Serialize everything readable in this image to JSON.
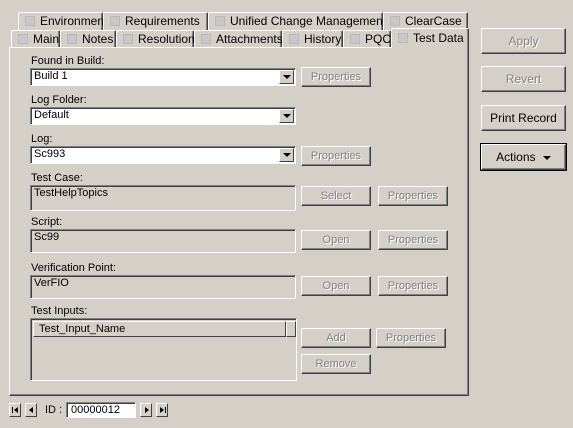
{
  "tabs_row1": [
    {
      "label": "Environment"
    },
    {
      "label": "Requirements"
    },
    {
      "label": "Unified Change Management"
    },
    {
      "label": "ClearCase"
    }
  ],
  "tabs_row2": [
    {
      "label": "Main"
    },
    {
      "label": "Notes"
    },
    {
      "label": "Resolution"
    },
    {
      "label": "Attachments"
    },
    {
      "label": "History"
    },
    {
      "label": "PQC"
    },
    {
      "label": "Test Data"
    }
  ],
  "form": {
    "found_in_build": {
      "label": "Found in Build:",
      "value": "Build 1",
      "button": "Properties"
    },
    "log_folder": {
      "label": "Log Folder:",
      "value": "Default"
    },
    "log": {
      "label": "Log:",
      "value": "Sc993",
      "button": "Properties"
    },
    "test_case": {
      "label": "Test Case:",
      "value": "TestHelpTopics",
      "select": "Select",
      "button": "Properties"
    },
    "script": {
      "label": "Script:",
      "value": "Sc99",
      "open": "Open",
      "button": "Properties"
    },
    "verification_point": {
      "label": "Verification Point:",
      "value": "VerFIO",
      "open": "Open",
      "button": "Properties"
    },
    "test_inputs": {
      "label": "Test Inputs:",
      "column": "Test_Input_Name",
      "add": "Add",
      "properties": "Properties",
      "remove": "Remove"
    }
  },
  "side": {
    "apply": "Apply",
    "revert": "Revert",
    "print": "Print Record",
    "actions": "Actions"
  },
  "nav": {
    "id_label": "ID :",
    "id_value": "00000012"
  },
  "colors": {
    "face": "#d4d0c8",
    "shadow": "#808080",
    "disabled_text": "#808080"
  }
}
